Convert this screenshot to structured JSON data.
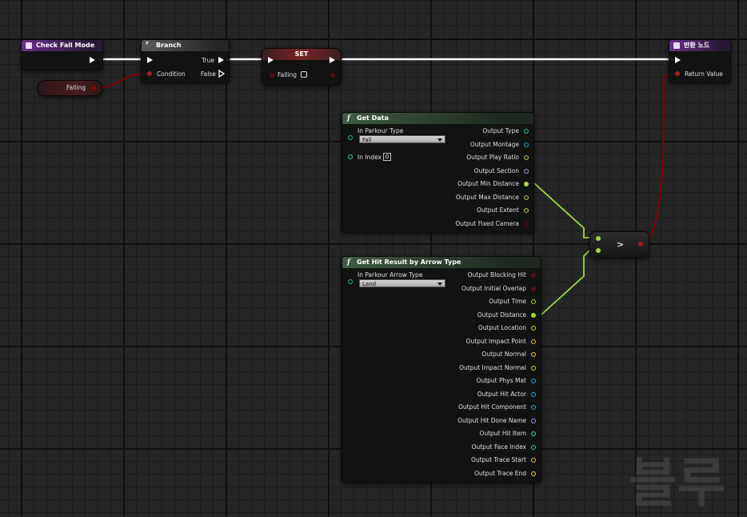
{
  "colors": {
    "exec": "#ffffff",
    "bool_pin": "#8b0000",
    "float_pin": "#9bdc3c",
    "byte_pin": "#00c4a6",
    "struct_pin": "#0a8fc3",
    "int_pin": "#22d3a0",
    "name_pin": "#b98cff",
    "vector_pin": "#f2c11a",
    "rotator_pin": "#89b6ff"
  },
  "nodes": {
    "check_fall_mode": {
      "title": "Check Fall Mode",
      "icon": "function-entry-icon"
    },
    "falling_getter": {
      "label": "Falling"
    },
    "branch": {
      "title": "Branch",
      "icon": "branch-icon",
      "condition": "Condition",
      "true_label": "True",
      "false_label": "False"
    },
    "set": {
      "title": "SET",
      "var_label": "Falling"
    },
    "return": {
      "title": "반환 노드",
      "icon": "return-icon",
      "return_value": "Return Value"
    },
    "get_data": {
      "title": "Get Data",
      "icon": "function-icon",
      "in_type_label": "In Parkour Type",
      "in_type_value": "Fall",
      "in_index_label": "In Index",
      "in_index_value": "0",
      "outputs": [
        "Output Type",
        "Output Montage",
        "Output Play Ratio",
        "Output Section",
        "Output Min Distance",
        "Output Max Distance",
        "Output Extent",
        "Output Fixed Camera"
      ]
    },
    "compare": {
      "op": ">"
    },
    "get_hit_result": {
      "title": "Get Hit Result by Arrow Type",
      "icon": "function-icon",
      "in_arrow_label": "In Parkour Arrow Type",
      "in_arrow_value": "Land",
      "outputs": [
        "Output Blocking Hit",
        "Output Initial Overlap",
        "Output Time",
        "Output Distance",
        "Output Location",
        "Output Impact Point",
        "Output Normal",
        "Output Impact Normal",
        "Output Phys Mat",
        "Output Hit Actor",
        "Output Hit Component",
        "Output Hit Done Name",
        "Output Hit Item",
        "Output Face Index",
        "Output Trace Start",
        "Output Trace End"
      ]
    }
  },
  "watermark": "블루"
}
